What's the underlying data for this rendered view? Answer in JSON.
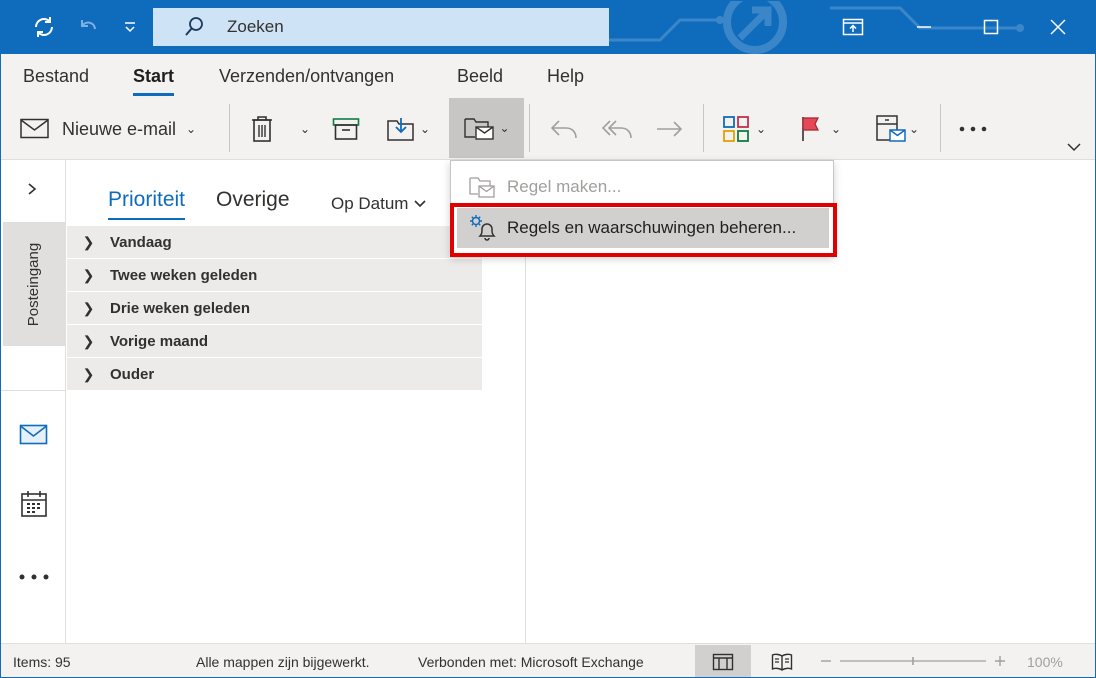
{
  "titlebar": {
    "search_placeholder": "Zoeken",
    "icons": [
      "sync-icon",
      "undo-icon",
      "customize-quick-access-icon",
      "search-icon",
      "ribbon-display-icon",
      "minimize-icon",
      "maximize-icon",
      "close-icon"
    ]
  },
  "ribbon": {
    "tabs": [
      {
        "label": "Bestand",
        "active": false
      },
      {
        "label": "Start",
        "active": true
      },
      {
        "label": "Verzenden/ontvangen",
        "active": false
      },
      {
        "label": "Beeld",
        "active": false
      },
      {
        "label": "Help",
        "active": false
      }
    ],
    "new_mail_label": "Nieuwe e-mail",
    "more_icon": "more-icon"
  },
  "dropdown": {
    "items": [
      {
        "label": "Regel maken...",
        "disabled": true,
        "icon": "create-rule-icon"
      },
      {
        "label": "Regels en waarschuwingen beheren...",
        "disabled": false,
        "highlighted": true,
        "icon": "manage-rules-alerts-icon"
      }
    ],
    "highlight_color": "#e00000"
  },
  "rail": {
    "folder_label": "Posteingang",
    "expand_icon": "chevron-right-icon",
    "nav_icons": [
      "mail-icon",
      "calendar-icon",
      "more-apps-icon"
    ]
  },
  "list": {
    "tabs": [
      {
        "label": "Prioriteit",
        "active": true
      },
      {
        "label": "Overige",
        "active": false
      }
    ],
    "sort_label": "Op Datum",
    "groups": [
      "Vandaag",
      "Twee weken geleden",
      "Drie weken geleden",
      "Vorige maand",
      "Ouder"
    ]
  },
  "status": {
    "items": "Items: 95",
    "sync": "Alle mappen zijn bijgewerkt.",
    "connection": "Verbonden met: Microsoft Exchange",
    "zoom": "100%"
  },
  "colors": {
    "accent": "#0f6cbd",
    "ribbon_bg": "#f3f2f1",
    "group_bg": "#edebe9"
  }
}
